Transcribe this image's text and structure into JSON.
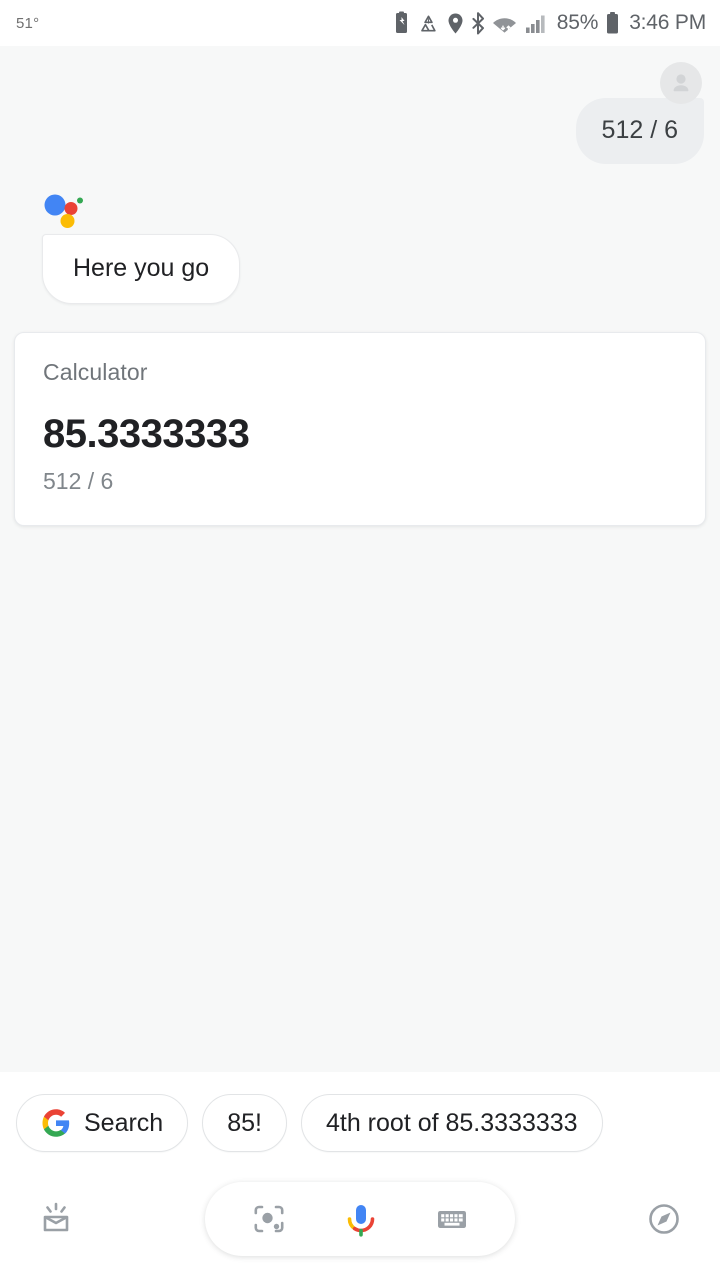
{
  "statusbar": {
    "temperature": "51°",
    "battery_percent": "85%",
    "clock": "3:46 PM",
    "icons": [
      "battery-saver-icon",
      "data-saver-icon",
      "location-icon",
      "bluetooth-icon",
      "wifi-icon",
      "cellular-signal-icon",
      "battery-icon"
    ]
  },
  "conversation": {
    "user_message": "512 / 6",
    "avatar_icon": "user-avatar-icon",
    "assistant_logo_icon": "google-assistant-logo-icon",
    "assistant_message": "Here you go",
    "card": {
      "label": "Calculator",
      "result": "85.3333333",
      "expression": "512 / 6"
    }
  },
  "suggestions": [
    {
      "icon": "google-g-icon",
      "label": "Search"
    },
    {
      "icon": "",
      "label": "85!"
    },
    {
      "icon": "",
      "label": "4th root of 85.3333333"
    }
  ],
  "toolbar": {
    "snapshot_icon": "snapshot-inbox-icon",
    "lens_icon": "google-lens-icon",
    "mic_icon": "google-mic-icon",
    "keyboard_icon": "keyboard-icon",
    "explore_icon": "explore-compass-icon"
  },
  "colors": {
    "google_blue": "#4285f4",
    "google_red": "#ea4335",
    "google_yellow": "#fbbc05",
    "google_green": "#34a853",
    "bubble_user_bg": "#eceef0",
    "page_bg": "#f7f8f8",
    "text_primary": "#202124",
    "text_secondary": "#70757a"
  }
}
